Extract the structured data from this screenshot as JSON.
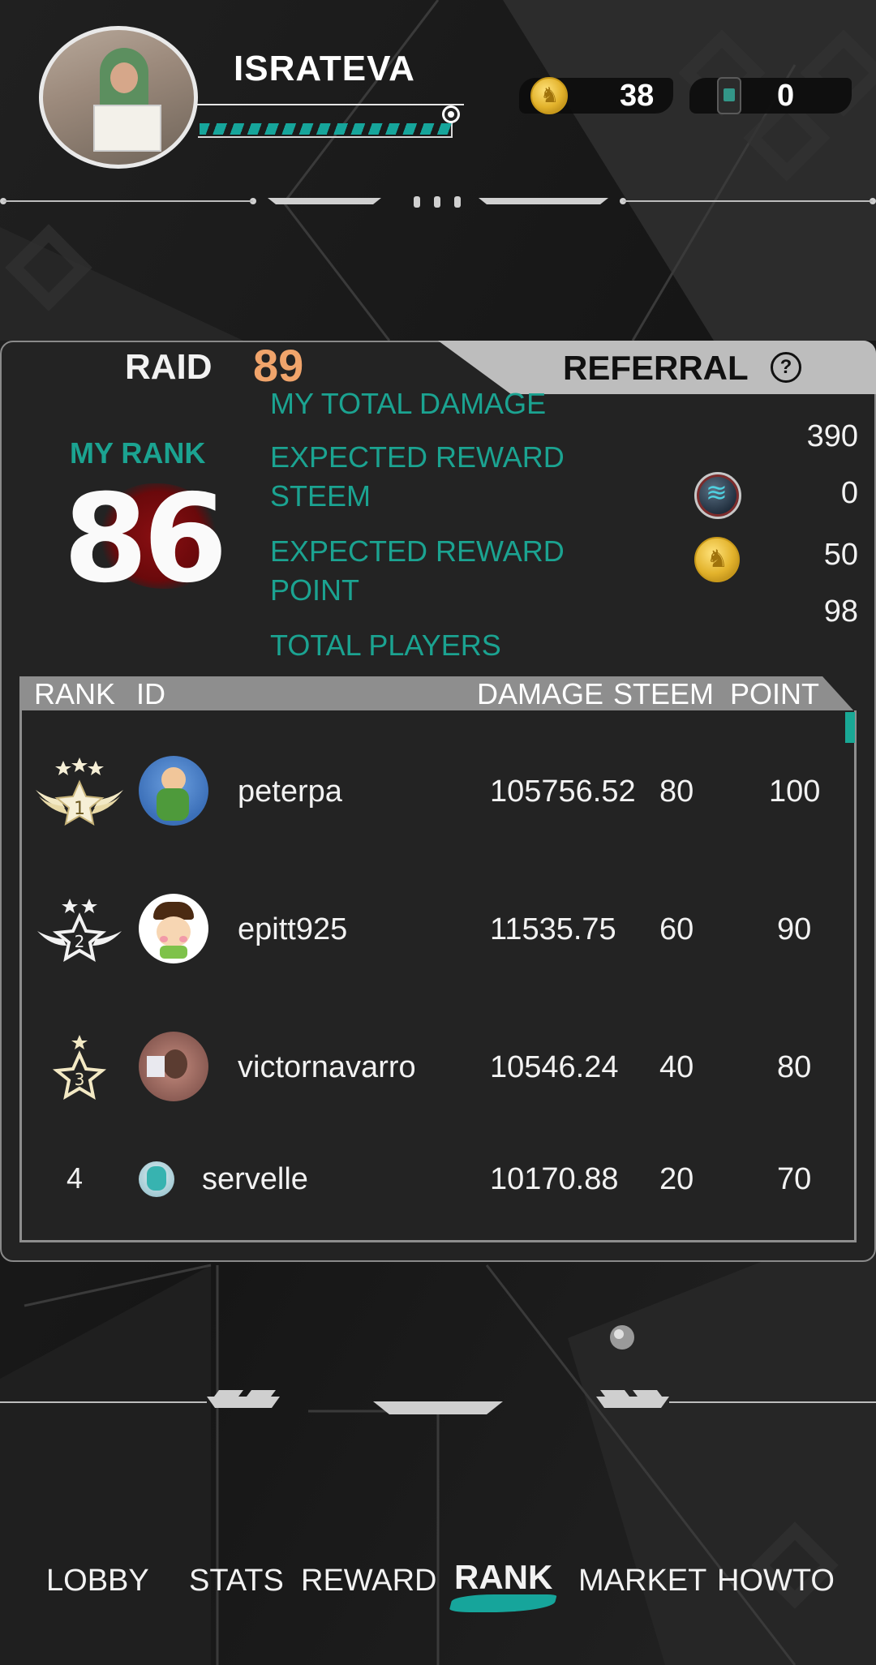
{
  "profile": {
    "username": "ISRATEVA",
    "xp_progress": 0.92
  },
  "currencies": [
    {
      "icon": "gold-coin-icon",
      "value": "38"
    },
    {
      "icon": "gadget-icon",
      "value": "0"
    }
  ],
  "tabs": {
    "raid_label": "RAID",
    "raid_count": "89",
    "referral_label": "REFERRAL",
    "help_glyph": "?"
  },
  "stats": {
    "my_rank_label": "MY RANK",
    "my_rank_value": "86",
    "total_damage_label": "MY TOTAL DAMAGE",
    "total_damage_value": "390",
    "reward_steem_label_1": "EXPECTED REWARD",
    "reward_steem_label_2": "STEEM",
    "reward_steem_value": "0",
    "reward_point_label_1": "EXPECTED REWARD",
    "reward_point_label_2": "POINT",
    "reward_point_value": "50",
    "total_players_label": "TOTAL PLAYERS",
    "total_players_value": "98"
  },
  "table": {
    "headers": {
      "rank": "RANK",
      "id": "ID",
      "damage": "DAMAGE",
      "steem": "STEEM",
      "point": "POINT"
    },
    "rows": [
      {
        "rank": "1",
        "id": "peterpa",
        "damage": "105756.52",
        "steem": "80",
        "point": "100"
      },
      {
        "rank": "2",
        "id": "epitt925",
        "damage": "11535.75",
        "steem": "60",
        "point": "90"
      },
      {
        "rank": "3",
        "id": "victornavarro",
        "damage": "10546.24",
        "steem": "40",
        "point": "80"
      },
      {
        "rank": "4",
        "id": "servelle",
        "damage": "10170.88",
        "steem": "20",
        "point": "70"
      }
    ]
  },
  "nav": {
    "items": [
      "LOBBY",
      "STATS",
      "REWARD",
      "RANK",
      "MARKET",
      "HOWTO"
    ],
    "active": "RANK"
  },
  "colors": {
    "accent_teal": "#1ba391",
    "raid_count": "#f0a46b",
    "blood_red": "#7a0c0e"
  }
}
